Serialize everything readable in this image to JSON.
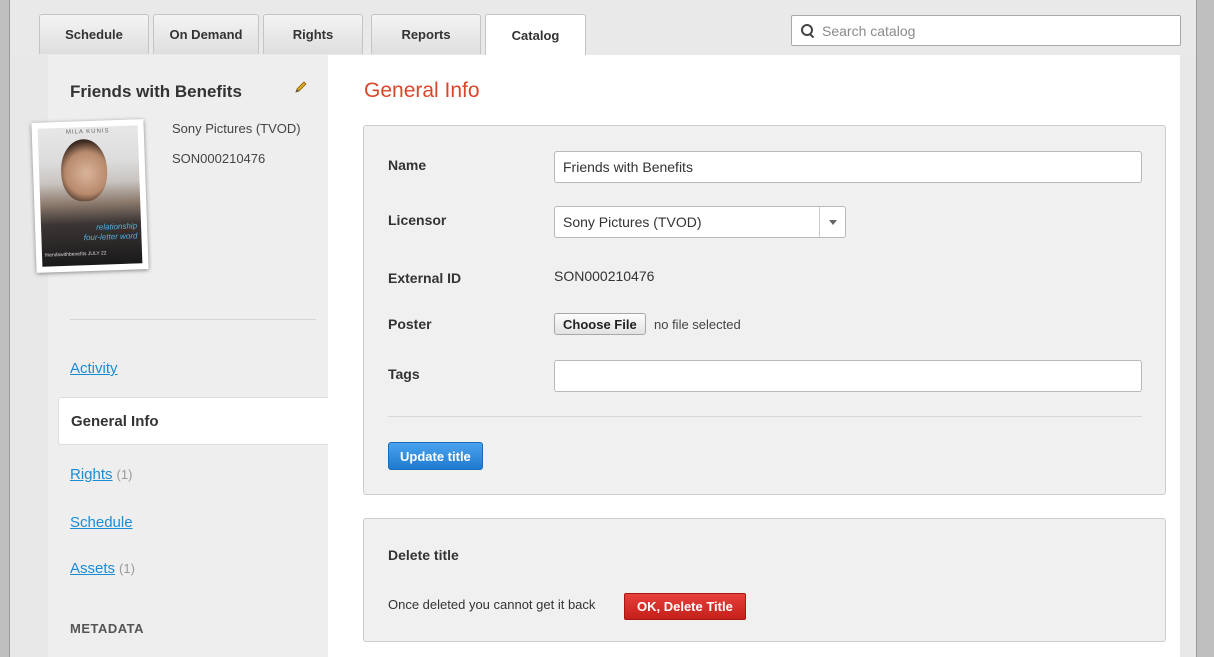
{
  "tabs": [
    {
      "label": "Schedule"
    },
    {
      "label": "On Demand"
    },
    {
      "label": "Rights"
    },
    {
      "label": "Reports"
    },
    {
      "label": "Catalog"
    }
  ],
  "active_tab": "Catalog",
  "search": {
    "placeholder": "Search catalog"
  },
  "sidebar": {
    "title": "Friends with Benefits",
    "licensor": "Sony Pictures (TVOD)",
    "external_id": "SON000210476",
    "poster": {
      "top_text": "MILA KUNIS",
      "tagline_1": "relationship",
      "tagline_2": "four-letter word",
      "bottom_text": "friendswithbenefits  JULY 22"
    },
    "links": {
      "activity": "Activity",
      "general_info": "General Info",
      "rights": "Rights",
      "rights_count": "(1)",
      "schedule": "Schedule",
      "assets": "Assets",
      "assets_count": "(1)"
    },
    "metadata_heading": "METADATA"
  },
  "main": {
    "page_title": "General Info",
    "form": {
      "name_label": "Name",
      "name_value": "Friends with Benefits",
      "licensor_label": "Licensor",
      "licensor_value": "Sony Pictures (TVOD)",
      "external_id_label": "External ID",
      "external_id_value": "SON000210476",
      "poster_label": "Poster",
      "choose_file_label": "Choose File",
      "no_file_text": "no file selected",
      "tags_label": "Tags",
      "tags_value": "",
      "update_button": "Update title"
    },
    "delete": {
      "heading": "Delete title",
      "note": "Once deleted you cannot get it back",
      "button": "OK, Delete Title"
    }
  },
  "colors": {
    "accent_title": "#d9472b",
    "link": "#1a8cd6",
    "primary_button": "#2b86da",
    "danger_button": "#d42f2a"
  }
}
